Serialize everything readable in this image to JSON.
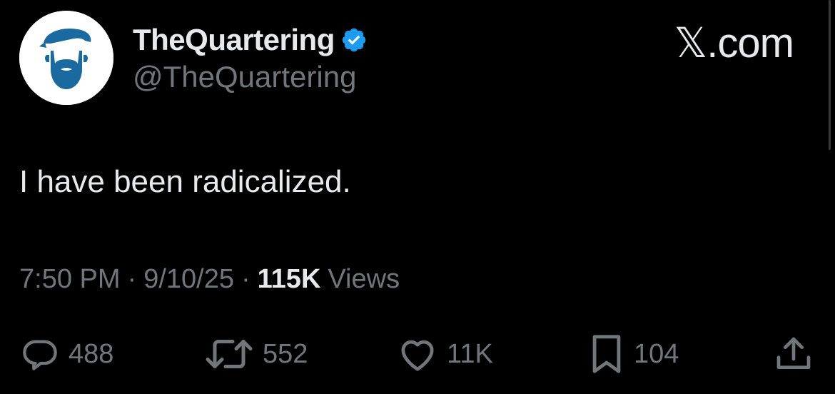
{
  "author": {
    "display_name": "TheQuartering",
    "handle": "@TheQuartering",
    "verified": true,
    "avatar_icon": "bearded-man-logo-icon"
  },
  "site": {
    "label": "𝕏.com"
  },
  "tweet": {
    "text": "I have been radicalized.",
    "time": "7:50 PM",
    "separator": "·",
    "date": "9/10/25",
    "views_count": "115K",
    "views_label": "Views"
  },
  "actions": {
    "replies": {
      "icon": "reply-icon",
      "count": "488"
    },
    "reposts": {
      "icon": "repost-icon",
      "count": "552"
    },
    "likes": {
      "icon": "heart-icon",
      "count": "11K"
    },
    "bookmarks": {
      "icon": "bookmark-icon",
      "count": "104"
    },
    "share": {
      "icon": "share-icon"
    }
  },
  "colors": {
    "background": "#000000",
    "primary_text": "#e7e9ea",
    "secondary_text": "#71767b",
    "verified_badge": "#1d9bf0",
    "avatar_logo": "#1a6aa0"
  }
}
